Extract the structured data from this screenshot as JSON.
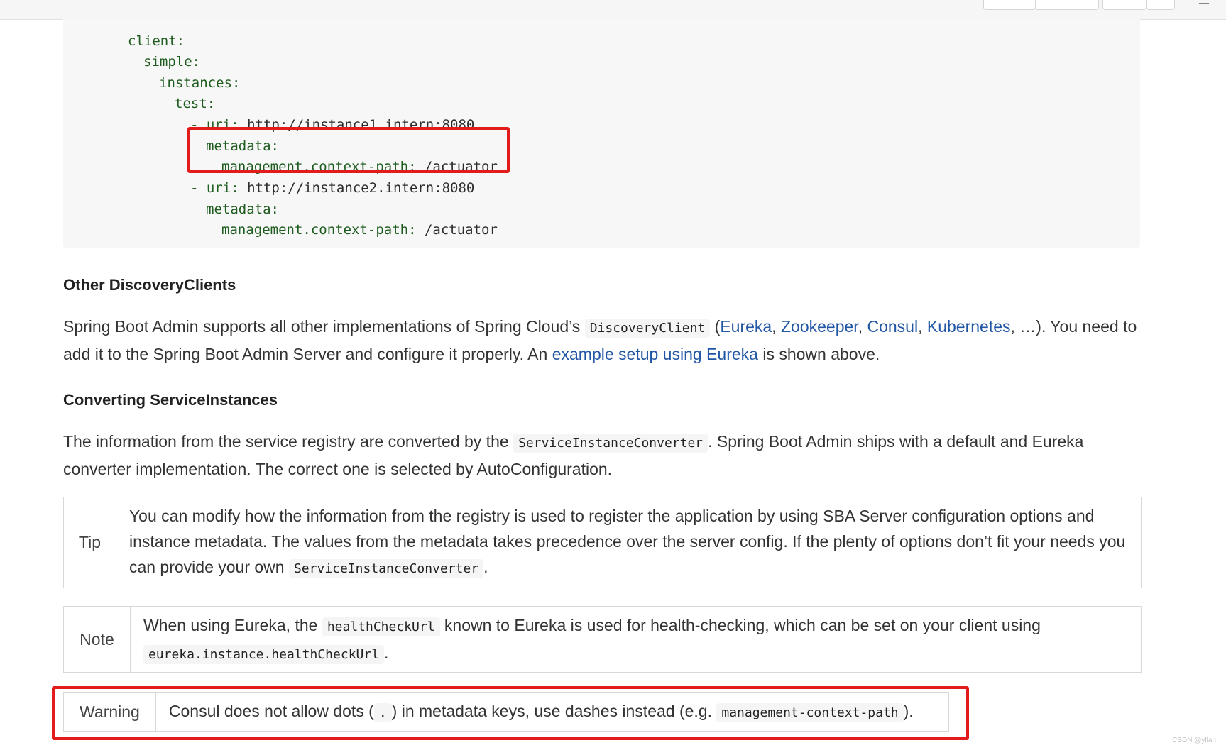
{
  "code": {
    "lines": [
      {
        "key": "client:",
        "value": ""
      },
      {
        "key": "simple:",
        "value": ""
      },
      {
        "key": "instances:",
        "value": ""
      },
      {
        "key": "test:",
        "value": ""
      },
      {
        "key": "- uri:",
        "value": " http://instance1.intern:8080"
      },
      {
        "key": "metadata:",
        "value": ""
      },
      {
        "key": "management.context-path:",
        "value": " /actuator"
      },
      {
        "key": "- uri:",
        "value": " http://instance2.intern:8080"
      },
      {
        "key": "metadata:",
        "value": ""
      },
      {
        "key": "management.context-path:",
        "value": " /actuator"
      }
    ]
  },
  "other_discovery": {
    "heading": "Other DiscoveryClients",
    "p_start": "Spring Boot Admin supports all other implementations of Spring Cloud’s ",
    "p_code": "DiscoveryClient",
    "p_open": " (",
    "links": [
      "Eureka",
      "Zookeeper",
      "Consul",
      "Kubernetes"
    ],
    "sep": ", ",
    "p_mid": ", …). You need to add it to the Spring Boot Admin Server and configure it properly. An ",
    "link_example": "example setup using Eureka",
    "p_end": " is shown above."
  },
  "converting": {
    "heading": "Converting ServiceInstances",
    "p_start": "The information from the service registry are converted by the ",
    "p_code": "ServiceInstanceConverter",
    "p_end": ". Spring Boot Admin ships with a default and Eureka converter implementation. The correct one is selected by AutoConfiguration."
  },
  "tip": {
    "label": "Tip",
    "text": "You can modify how the information from the registry is used to register the application by using SBA Server configuration options and instance metadata. The values from the metadata takes precedence over the server config. If the plenty of options don’t fit your needs you can provide your own ",
    "code": "ServiceInstanceConverter",
    "end": "."
  },
  "note": {
    "label": "Note",
    "text1": "When using Eureka, the ",
    "code1": "healthCheckUrl",
    "text2": " known to Eureka is used for health-checking, which can be set on your client using ",
    "code2": "eureka.instance.healthCheckUrl",
    "end": "."
  },
  "warning": {
    "label": "Warning",
    "text1": "Consul does not allow dots (",
    "code1": ".",
    "text2": ") in metadata keys, use dashes instead (e.g. ",
    "code2": "management-context-path",
    "end": ")."
  },
  "watermark": "CSDN @yllan",
  "colors": {
    "highlight": "#e21b1b",
    "link": "#2156a5",
    "code_bg": "#f7f7f7"
  }
}
